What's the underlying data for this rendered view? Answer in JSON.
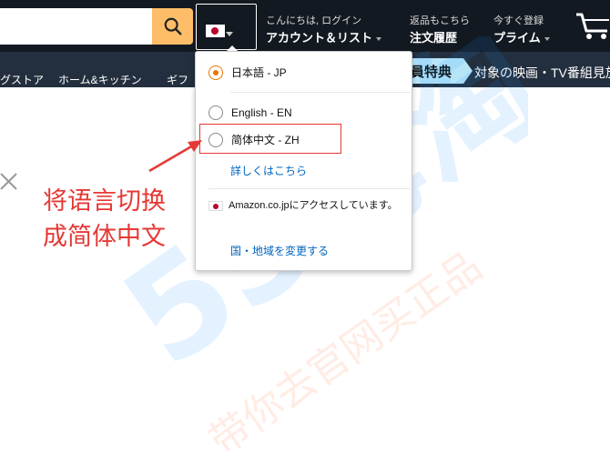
{
  "nav": {
    "greeting": "こんにちは, ログイン",
    "account_label": "アカウント＆リスト",
    "returns_label": "返品もこちら",
    "orders_label": "注文履歴",
    "register_label": "今すぐ登録",
    "prime_label": "プライム",
    "flag_icon": "japan-flag-icon",
    "search_icon": "search-icon",
    "cart_icon": "cart-icon"
  },
  "subnav": {
    "items": [
      "グストア",
      "ホーム&キッチン",
      "ギフ"
    ],
    "promo_label": "員特典",
    "promo_text": "対象の映画・TV番組見放"
  },
  "language_menu": {
    "options": [
      {
        "label": "日本語 - JP",
        "selected": true
      },
      {
        "label": "English - EN",
        "selected": false
      },
      {
        "label": "简体中文 - ZH",
        "selected": false
      }
    ],
    "learn_more": "詳しくはこちら",
    "notice": "Amazon.co.jpにアクセスしています。",
    "change_region": "国・地域を変更する"
  },
  "annotation": {
    "line1": "将语言切换",
    "line2": "成简体中文"
  },
  "watermark": {
    "line1": "55海淘",
    "line2": "带你去官网买正品"
  },
  "colors": {
    "nav_bg": "#131921",
    "subnav_bg": "#232f3e",
    "search_button": "#febd69",
    "radio_selected": "#e77600",
    "link": "#0066c0",
    "annotation": "#e53935"
  }
}
